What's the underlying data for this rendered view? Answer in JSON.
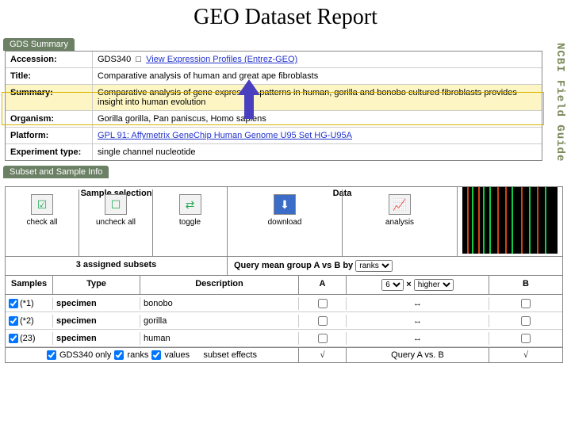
{
  "page": {
    "title": "GEO Dataset Report",
    "side_label": "NCBI Field Guide"
  },
  "summary_tab": "GDS Summary",
  "summary": {
    "accession_label": "Accession:",
    "accession_value": "GDS340",
    "accession_link": "View Expression Profiles (Entrez-GEO)",
    "title_label": "Title:",
    "title_value": "Comparative analysis of human and great ape fibroblasts",
    "summary_label": "Summary:",
    "summary_value": "Comparative analysis of gene expression patterns in human, gorilla and bonobo cultured fibroblasts provides insight into human evolution",
    "organism_label": "Organism:",
    "organism_value": "Gorilla gorilla, Pan paniscus, Homo sapiens",
    "platform_label": "Platform:",
    "platform_value": "GPL 91: Affymetrix GeneChip Human Genome U95 Set HG-U95A",
    "exptype_label": "Experiment type:",
    "exptype_value": "single channel nucleotide"
  },
  "subset_tab": "Subset and Sample Info",
  "headers": {
    "sample_selection": "Sample selection",
    "data": "Data",
    "check_all": "check all",
    "uncheck_all": "uncheck all",
    "toggle": "toggle",
    "download": "download",
    "analysis": "analysis",
    "assigned_subsets": "3 assigned subsets",
    "query_mean": "Query mean group A vs B by",
    "samples": "Samples",
    "type": "Type",
    "description": "Description",
    "a": "A",
    "b": "B",
    "arrow": "↔"
  },
  "rows": [
    {
      "n": "(*1)",
      "type": "specimen",
      "desc": "bonobo"
    },
    {
      "n": "(*2)",
      "type": "specimen",
      "desc": "gorilla"
    },
    {
      "n": "(23)",
      "type": "specimen",
      "desc": "human"
    }
  ],
  "footer": {
    "gds_only": "GDS340 only",
    "ranks": "ranks",
    "values": "values",
    "subset_effects": "subset effects",
    "query_ab": "Query A vs. B"
  },
  "controls": {
    "rank_option": "ranks",
    "num_option": "6",
    "times": "×",
    "higher_option": "higher"
  }
}
